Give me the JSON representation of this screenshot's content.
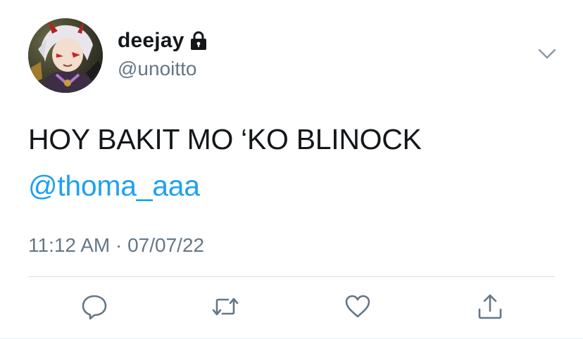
{
  "author": {
    "display_name": "deejay",
    "handle": "@unoitto",
    "protected_icon": "lock-icon",
    "avatar": "avatar-image"
  },
  "tweet": {
    "text": "HOY BAKIT MO ‘KO BLINOCK",
    "mention": "@thoma_aaa",
    "timestamp": "11:12 AM · 07/07/22"
  },
  "menu_icon": "chevron-down-icon",
  "actions": [
    "reply-icon",
    "retweet-icon",
    "like-icon",
    "share-icon"
  ],
  "colors": {
    "text": "#14171a",
    "secondary": "#657786",
    "link": "#1da1f2",
    "icon": "#657786",
    "divider": "#d9dee2"
  }
}
